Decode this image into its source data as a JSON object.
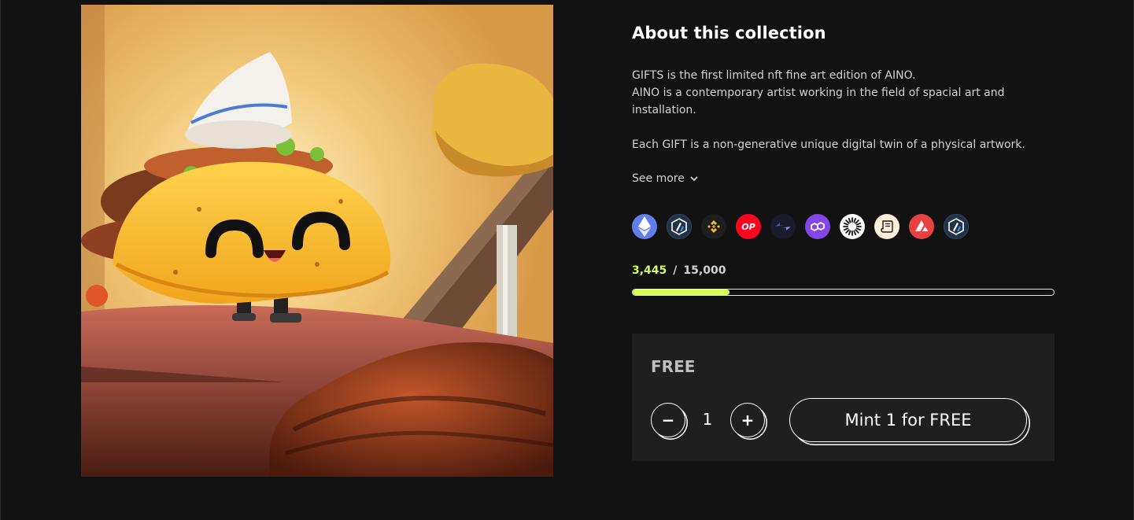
{
  "collection": {
    "title": "About this collection",
    "description": [
      "GIFTS is the first limited nft fine art edition of AINO.",
      "AINO is a contemporary artist working in the field of spacial art and installation.",
      "Each GIFT is a non-generative unique digital twin of a physical artwork."
    ],
    "see_more_label": "See more",
    "artwork_icon": "taco-artwork-image"
  },
  "chains": [
    {
      "icon": "ethereum-icon",
      "bg": "#627eea"
    },
    {
      "icon": "arbitrum-icon",
      "bg": "#213147"
    },
    {
      "icon": "bnb-chain-icon",
      "bg": "#1e1e1e"
    },
    {
      "icon": "optimism-icon",
      "bg": "#ff0420",
      "text": "OP"
    },
    {
      "icon": "zksync-icon",
      "bg": "#1b1b2e"
    },
    {
      "icon": "polygon-icon",
      "bg": "#8247e5"
    },
    {
      "icon": "zora-icon",
      "bg": "#ffffff"
    },
    {
      "icon": "scroll-icon",
      "bg": "#ffeeda"
    },
    {
      "icon": "avalanche-icon",
      "bg": "#e84142"
    },
    {
      "icon": "arbitrum-nova-icon",
      "bg": "#213147"
    }
  ],
  "supply": {
    "minted": "3,445",
    "separator": "/",
    "total": "15,000",
    "progress_fraction": 0.2297
  },
  "mint": {
    "price_label": "FREE",
    "decrement_label": "−",
    "quantity": "1",
    "increment_label": "+",
    "mint_button_label": "Mint 1 for FREE"
  },
  "colors": {
    "background": "#121212",
    "card": "#1f1f1f",
    "accent": "#d7ff5a"
  }
}
